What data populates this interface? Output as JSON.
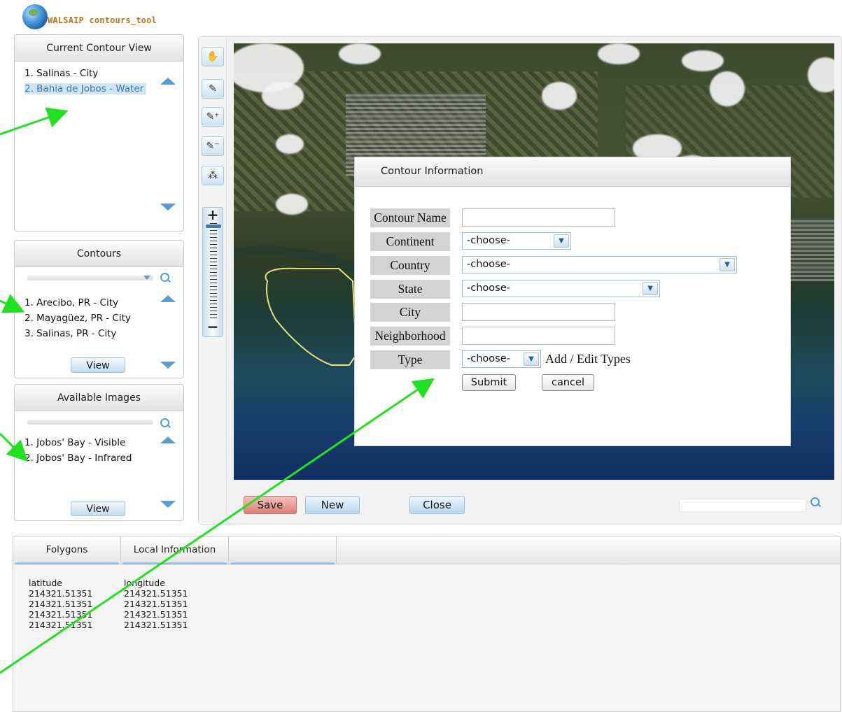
{
  "app": {
    "logo_text": "WALSAIP contours_tool"
  },
  "current_contour_view": {
    "title": "Current Contour View",
    "items": [
      {
        "label": "1. Salinas - City",
        "selected": false
      },
      {
        "label": "2. Bahia de Jobos - Water",
        "selected": true
      }
    ]
  },
  "contours": {
    "title": "Contours",
    "items": [
      "1. Arecibo, PR - City",
      "2. Mayagüez, PR - City",
      "3. Salinas, PR - City"
    ],
    "view_label": "View"
  },
  "available_images": {
    "title": "Available Images",
    "items": [
      "1. Jobos' Bay - Visible",
      "2. Jobos' Bay - Infrared"
    ],
    "view_label": "View"
  },
  "map_toolbar": {
    "tools": [
      "hand-icon",
      "pen-icon",
      "pen-add-icon",
      "pen-remove-icon",
      "move-points-icon"
    ],
    "zoom_in": "+",
    "zoom_out": "−",
    "zoom_level": 1.0
  },
  "map_actions": {
    "save": "Save",
    "new": "New",
    "close": "Close",
    "search_value": ""
  },
  "dialog": {
    "title": "Contour Information",
    "fields": {
      "contour_name": {
        "label": "Contour Name",
        "value": ""
      },
      "continent": {
        "label": "Continent",
        "selected": "-choose-"
      },
      "country": {
        "label": "Country",
        "selected": "-choose-"
      },
      "state": {
        "label": "State",
        "selected": "-choose-"
      },
      "city": {
        "label": "City",
        "value": ""
      },
      "neighborhood": {
        "label": "Neighborhood",
        "value": ""
      },
      "type": {
        "label": "Type",
        "selected": "-choose-"
      }
    },
    "add_edit_types": "Add / Edit Types",
    "submit": "Submit",
    "cancel": "cancel"
  },
  "bottom_tabs": {
    "tabs": [
      "Folygons",
      "Local Information",
      ""
    ],
    "headers": {
      "latitude": "latitude",
      "longitude": "longitude"
    },
    "rows": [
      [
        "214321.51351",
        "214321.51351"
      ],
      [
        "214321.51351",
        "214321.51351"
      ],
      [
        "214321.51351",
        "214321.51351"
      ],
      [
        "214321.51351",
        "214321.51351"
      ]
    ]
  },
  "colors": {
    "accent_blue": "#5a9bd0",
    "save_red": "#d97f76",
    "annotation_arrow": "#22e022",
    "contour_yellow": "#e6e07a"
  }
}
